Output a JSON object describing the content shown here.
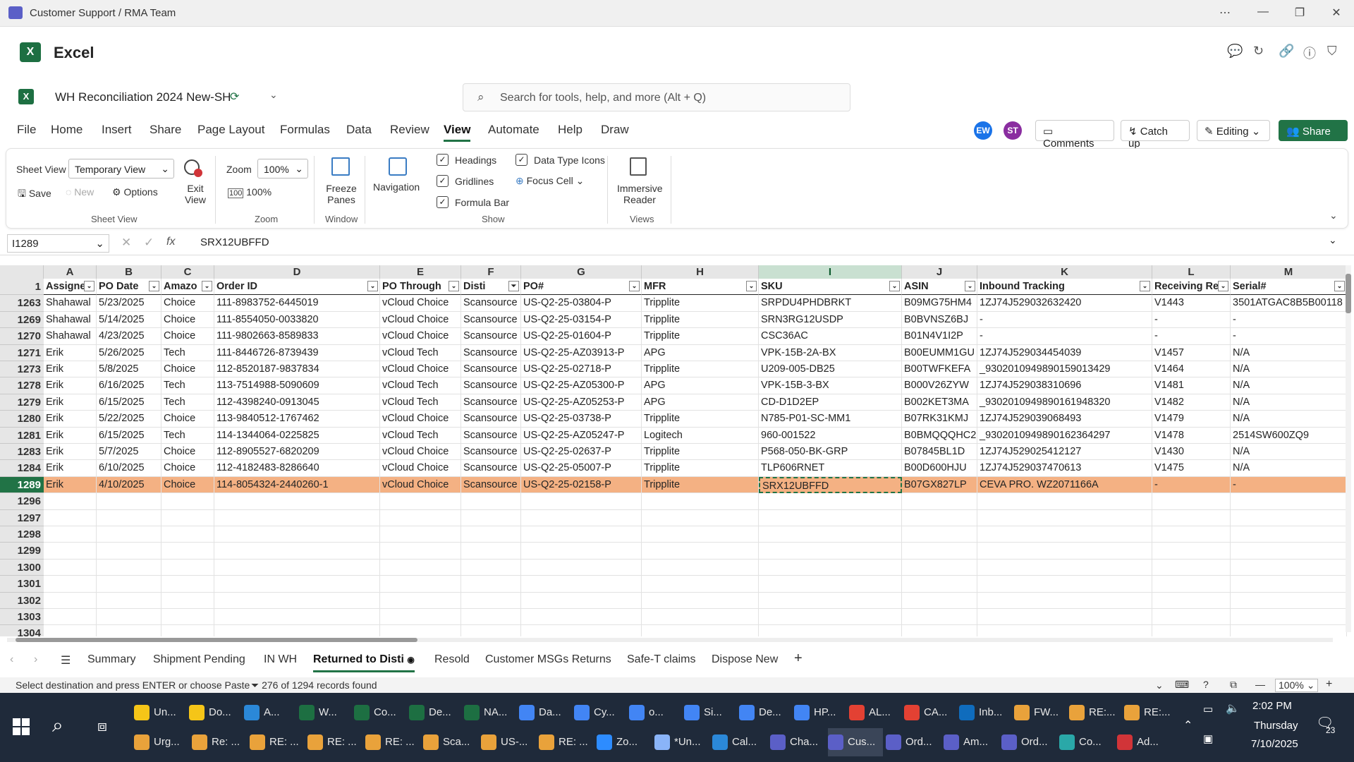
{
  "window": {
    "title": "Customer Support / RMA Team"
  },
  "app": {
    "name": "Excel"
  },
  "doc": {
    "title": "WH Reconciliation 2024 New-SH"
  },
  "search": {
    "placeholder": "Search for tools, help, and more (Alt + Q)"
  },
  "menu": [
    "File",
    "Home",
    "Insert",
    "Share",
    "Page Layout",
    "Formulas",
    "Data",
    "Review",
    "View",
    "Automate",
    "Help",
    "Draw"
  ],
  "menu_active": "View",
  "header_buttons": {
    "avatar1": "EW",
    "avatar2": "ST",
    "comments": "Comments",
    "catchup": "Catch up",
    "editing": "Editing",
    "share": "Share"
  },
  "ribbon": {
    "sheet_view_label": "Sheet View",
    "sheet_view_value": "Temporary View",
    "save": "Save",
    "new": "New",
    "options": "Options",
    "exit_view": "Exit View",
    "group_sheet_view": "Sheet View",
    "zoom_label": "Zoom",
    "zoom_value": "100%",
    "zoom_100": "100%",
    "group_zoom": "Zoom",
    "freeze_panes": "Freeze Panes",
    "group_window": "Window",
    "navigation": "Navigation",
    "headings": "Headings",
    "gridlines": "Gridlines",
    "formula_bar": "Formula Bar",
    "data_type_icons": "Data Type Icons",
    "focus_cell": "Focus Cell",
    "group_show": "Show",
    "immersive_reader": "Immersive Reader",
    "group_views": "Views"
  },
  "formula": {
    "namebox": "I1289",
    "fx": "fx",
    "value": "SRX12UBFFD"
  },
  "columns": [
    "A",
    "B",
    "C",
    "D",
    "E",
    "F",
    "G",
    "H",
    "I",
    "J",
    "K",
    "L",
    "M"
  ],
  "header_row": {
    "row": "1",
    "cells": [
      "Assigne",
      "PO Date",
      "Amazo",
      "Order ID",
      "PO Through",
      "Disti",
      "PO#",
      "MFR",
      "SKU",
      "ASIN",
      "Inbound Tracking",
      "Receiving Re",
      "Serial#"
    ]
  },
  "rows": [
    {
      "row": "1263",
      "cells": [
        "Shahawal",
        "5/23/2025",
        "Choice",
        "111-8983752-6445019",
        "vCloud Choice",
        "Scansource",
        "US-Q2-25-03804-P",
        "Tripplite",
        "SRPDU4PHDBRKT",
        "B09MG75HM4",
        "1ZJ74J529032632420",
        "V1443",
        "3501ATGAC8B5B00118"
      ]
    },
    {
      "row": "1269",
      "cells": [
        "Shahawal",
        "5/14/2025",
        "Choice",
        "111-8554050-0033820",
        "vCloud Choice",
        "Scansource",
        "US-Q2-25-03154-P",
        "Tripplite",
        "SRN3RG12USDP",
        "B0BVNSZ6BJ",
        "-",
        "-",
        "-"
      ]
    },
    {
      "row": "1270",
      "cells": [
        "Shahawal",
        "4/23/2025",
        "Choice",
        "111-9802663-8589833",
        "vCloud Choice",
        "Scansource",
        "US-Q2-25-01604-P",
        "Tripplite",
        "CSC36AC",
        "B01N4V1I2P",
        "-",
        "-",
        "-"
      ]
    },
    {
      "row": "1271",
      "cells": [
        "Erik",
        "5/26/2025",
        "Tech",
        "111-8446726-8739439",
        "vCloud Tech",
        "Scansource",
        "US-Q2-25-AZ03913-P",
        "APG",
        "VPK-15B-2A-BX",
        "B00EUMM1GU",
        "1ZJ74J529034454039",
        "V1457",
        "N/A"
      ]
    },
    {
      "row": "1273",
      "cells": [
        "Erik",
        "5/8/2025",
        "Choice",
        "112-8520187-9837834",
        "vCloud Choice",
        "Scansource",
        "US-Q2-25-02718-P",
        "Tripplite",
        "U209-005-DB25",
        "B00TWFKEFA",
        "_930201094989015901342​9",
        "V1464",
        "N/A"
      ]
    },
    {
      "row": "1278",
      "cells": [
        "Erik",
        "6/16/2025",
        "Tech",
        "113-7514988-5090609",
        "vCloud Tech",
        "Scansource",
        "US-Q2-25-AZ05300-P",
        "APG",
        "VPK-15B-3-BX",
        "B000V26ZYW",
        "1ZJ74J529038310696",
        "V1481",
        "N/A"
      ]
    },
    {
      "row": "1279",
      "cells": [
        "Erik",
        "6/15/2025",
        "Tech",
        "112-4398240-0913045",
        "vCloud Tech",
        "Scansource",
        "US-Q2-25-AZ05253-P",
        "APG",
        "CD-D1D2EP",
        "B002KET3MA",
        "_930201094989016194832​0",
        "V1482",
        "N/A"
      ]
    },
    {
      "row": "1280",
      "cells": [
        "Erik",
        "5/22/2025",
        "Choice",
        "113-9840512-1767462",
        "vCloud Choice",
        "Scansource",
        "US-Q2-25-03738-P",
        "Tripplite",
        "N785-P01-SC-MM1",
        "B07RK31KMJ",
        "1ZJ74J529039068493",
        "V1479",
        "N/A"
      ]
    },
    {
      "row": "1281",
      "cells": [
        "Erik",
        "6/15/2025",
        "Tech",
        "114-1344064-0225825",
        "vCloud Tech",
        "Scansource",
        "US-Q2-25-AZ05247-P",
        "Logitech",
        "960-001522",
        "B0BMQQQHC2",
        "_930201094989016236429​7",
        "V1478",
        "2514SW600ZQ9"
      ]
    },
    {
      "row": "1283",
      "cells": [
        "Erik",
        "5/7/2025",
        "Choice",
        "112-8905527-6820209",
        "vCloud Choice",
        "Scansource",
        "US-Q2-25-02637-P",
        "Tripplite",
        "P568-050-BK-GRP",
        "B07845BL1D",
        "1ZJ74J529025412127",
        "V1430",
        "N/A"
      ]
    },
    {
      "row": "1284",
      "cells": [
        "Erik",
        "6/10/2025",
        "Choice",
        "112-4182483-8286640",
        "vCloud Choice",
        "Scansource",
        "US-Q2-25-05007-P",
        "Tripplite",
        "TLP606RNET",
        "B00D600HJU",
        "1ZJ74J529037470613",
        "V1475",
        "N/A"
      ]
    },
    {
      "row": "1289",
      "cells": [
        "Erik",
        "4/10/2025",
        "Choice",
        "114-8054324-2440260-1",
        "vCloud Choice",
        "Scansource",
        "US-Q2-25-02158-P",
        "Tripplite",
        "SRX12UBFFD",
        "B07GX827LP",
        "CEVA PRO. WZ2071166A",
        "-",
        "-"
      ]
    }
  ],
  "empty_rows": [
    "1296",
    "1297",
    "1298",
    "1299",
    "1300",
    "1301",
    "1302",
    "1303",
    "1304"
  ],
  "sheet_tabs": [
    "Summary",
    "Shipment Pending",
    "IN WH",
    "Returned to Disti",
    "Resold",
    "Customer MSGs Returns",
    "Safe-T claims",
    "Dispose New"
  ],
  "active_tab": "Returned to Disti",
  "status": {
    "message": "Select destination and press ENTER or choose Paste",
    "filter": "276 of 1294 records found",
    "zoom": "100%"
  },
  "taskbar": {
    "row1": [
      "Un...",
      "Do...",
      "A...",
      "W...",
      "Co...",
      "De...",
      "NA...",
      "Da...",
      "Cy...",
      "o...",
      "Si...",
      "De...",
      "HP...",
      "AL...",
      "CA...",
      "Inb...",
      "FW...",
      "RE:...",
      "RE:..."
    ],
    "row2": [
      "Urg...",
      "Re: ...",
      "RE: ...",
      "RE: ...",
      "RE: ...",
      "Sca...",
      "US-...",
      "RE: ...",
      "Zo...",
      "*Un...",
      "Cal...",
      "Cha...",
      "Cus...",
      "Ord...",
      "Am...",
      "Ord...",
      "Co...",
      "Ad..."
    ],
    "time": "2:02 PM",
    "day": "Thursday",
    "date": "7/10/2025",
    "notif": "23"
  }
}
